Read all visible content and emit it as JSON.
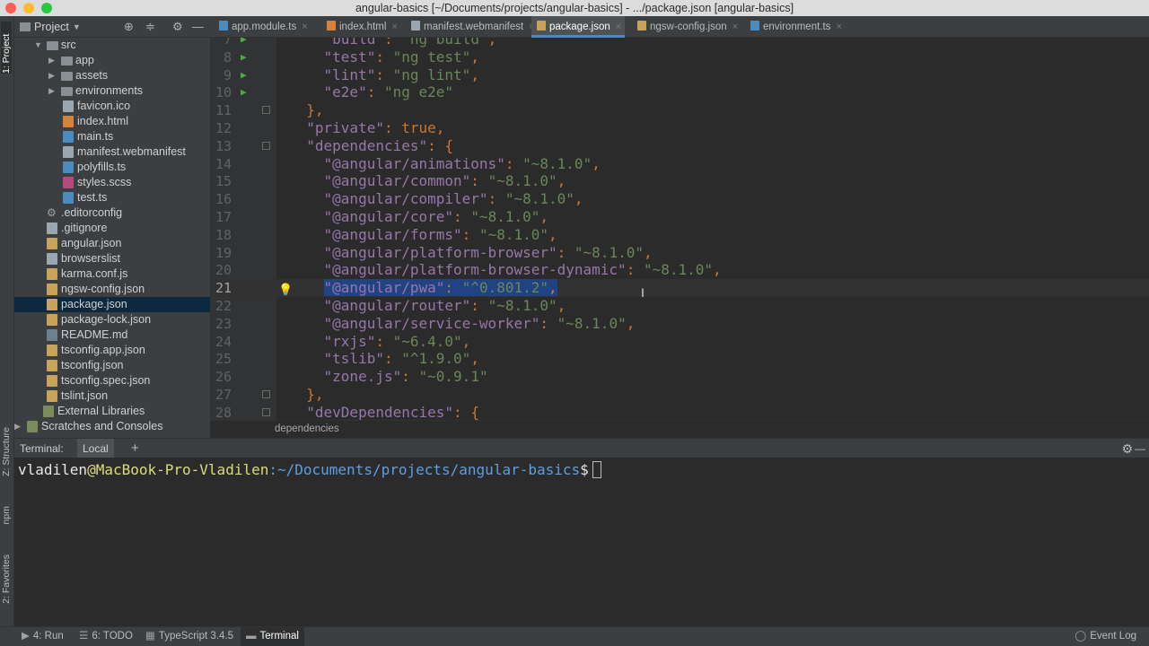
{
  "window": {
    "title": "angular-basics [~/Documents/projects/angular-basics] - .../package.json [angular-basics]"
  },
  "left_strip": {
    "project": "1: Project",
    "structure": "Z: Structure",
    "npm": "npm",
    "favorites": "2: Favorites"
  },
  "project_panel": {
    "title": "Project",
    "tree": [
      {
        "label": "src",
        "type": "folder",
        "expanded": true
      },
      {
        "label": "app",
        "type": "folder"
      },
      {
        "label": "assets",
        "type": "folder"
      },
      {
        "label": "environments",
        "type": "folder"
      },
      {
        "label": "favicon.ico",
        "type": "file"
      },
      {
        "label": "index.html",
        "type": "html"
      },
      {
        "label": "main.ts",
        "type": "ts"
      },
      {
        "label": "manifest.webmanifest",
        "type": "file"
      },
      {
        "label": "polyfills.ts",
        "type": "ts"
      },
      {
        "label": "styles.scss",
        "type": "scss"
      },
      {
        "label": "test.ts",
        "type": "ts"
      },
      {
        "label": ".editorconfig",
        "type": "gear"
      },
      {
        "label": ".gitignore",
        "type": "file"
      },
      {
        "label": "angular.json",
        "type": "json"
      },
      {
        "label": "browserslist",
        "type": "file"
      },
      {
        "label": "karma.conf.js",
        "type": "json"
      },
      {
        "label": "ngsw-config.json",
        "type": "json"
      },
      {
        "label": "package.json",
        "type": "json",
        "selected": true
      },
      {
        "label": "package-lock.json",
        "type": "json"
      },
      {
        "label": "README.md",
        "type": "md"
      },
      {
        "label": "tsconfig.app.json",
        "type": "json"
      },
      {
        "label": "tsconfig.json",
        "type": "json"
      },
      {
        "label": "tsconfig.spec.json",
        "type": "json"
      },
      {
        "label": "tslint.json",
        "type": "json"
      },
      {
        "label": "External Libraries",
        "type": "lib"
      },
      {
        "label": "Scratches and Consoles",
        "type": "lib"
      }
    ]
  },
  "tabs": [
    {
      "label": "app.module.ts",
      "active": false
    },
    {
      "label": "index.html",
      "active": false
    },
    {
      "label": "manifest.webmanifest",
      "active": false
    },
    {
      "label": "package.json",
      "active": true
    },
    {
      "label": "ngsw-config.json",
      "active": false
    },
    {
      "label": "environment.ts",
      "active": false
    }
  ],
  "editor": {
    "lines": [
      {
        "n": "7",
        "text": "    \"build\": \"ng build\",",
        "run": true
      },
      {
        "n": "8",
        "text": "    \"test\": \"ng test\",",
        "run": true
      },
      {
        "n": "9",
        "text": "    \"lint\": \"ng lint\",",
        "run": true
      },
      {
        "n": "10",
        "text": "    \"e2e\": \"ng e2e\"",
        "run": true
      },
      {
        "n": "11",
        "text": "  },",
        "fold": true
      },
      {
        "n": "12",
        "text": "  \"private\": true,"
      },
      {
        "n": "13",
        "text": "  \"dependencies\": {",
        "fold": true
      },
      {
        "n": "14",
        "text": "    \"@angular/animations\": \"~8.1.0\","
      },
      {
        "n": "15",
        "text": "    \"@angular/common\": \"~8.1.0\","
      },
      {
        "n": "16",
        "text": "    \"@angular/compiler\": \"~8.1.0\","
      },
      {
        "n": "17",
        "text": "    \"@angular/core\": \"~8.1.0\","
      },
      {
        "n": "18",
        "text": "    \"@angular/forms\": \"~8.1.0\","
      },
      {
        "n": "19",
        "text": "    \"@angular/platform-browser\": \"~8.1.0\","
      },
      {
        "n": "20",
        "text": "    \"@angular/platform-browser-dynamic\": \"~8.1.0\","
      },
      {
        "n": "21",
        "text": "    \"@angular/pwa\": \"^0.801.2\",",
        "current": true
      },
      {
        "n": "22",
        "text": "    \"@angular/router\": \"~8.1.0\","
      },
      {
        "n": "23",
        "text": "    \"@angular/service-worker\": \"~8.1.0\","
      },
      {
        "n": "24",
        "text": "    \"rxjs\": \"~6.4.0\","
      },
      {
        "n": "25",
        "text": "    \"tslib\": \"^1.9.0\","
      },
      {
        "n": "26",
        "text": "    \"zone.js\": \"~0.9.1\""
      },
      {
        "n": "27",
        "text": "  },",
        "fold": true
      },
      {
        "n": "28",
        "text": "  \"devDependencies\": {",
        "fold": true
      }
    ]
  },
  "breadcrumb": "dependencies",
  "terminal": {
    "header_label": "Terminal:",
    "tab": "Local",
    "plus": "+",
    "prompt_user": "vladilen",
    "prompt_host": "@MacBook-Pro-Vladilen",
    "prompt_path": ":~/Documents/projects/angular-basics",
    "prompt_char": "$"
  },
  "statusbar": {
    "run": "4: Run",
    "todo": "6: TODO",
    "typescript": "TypeScript 3.4.5",
    "terminal": "Terminal",
    "event_log": "Event Log"
  }
}
